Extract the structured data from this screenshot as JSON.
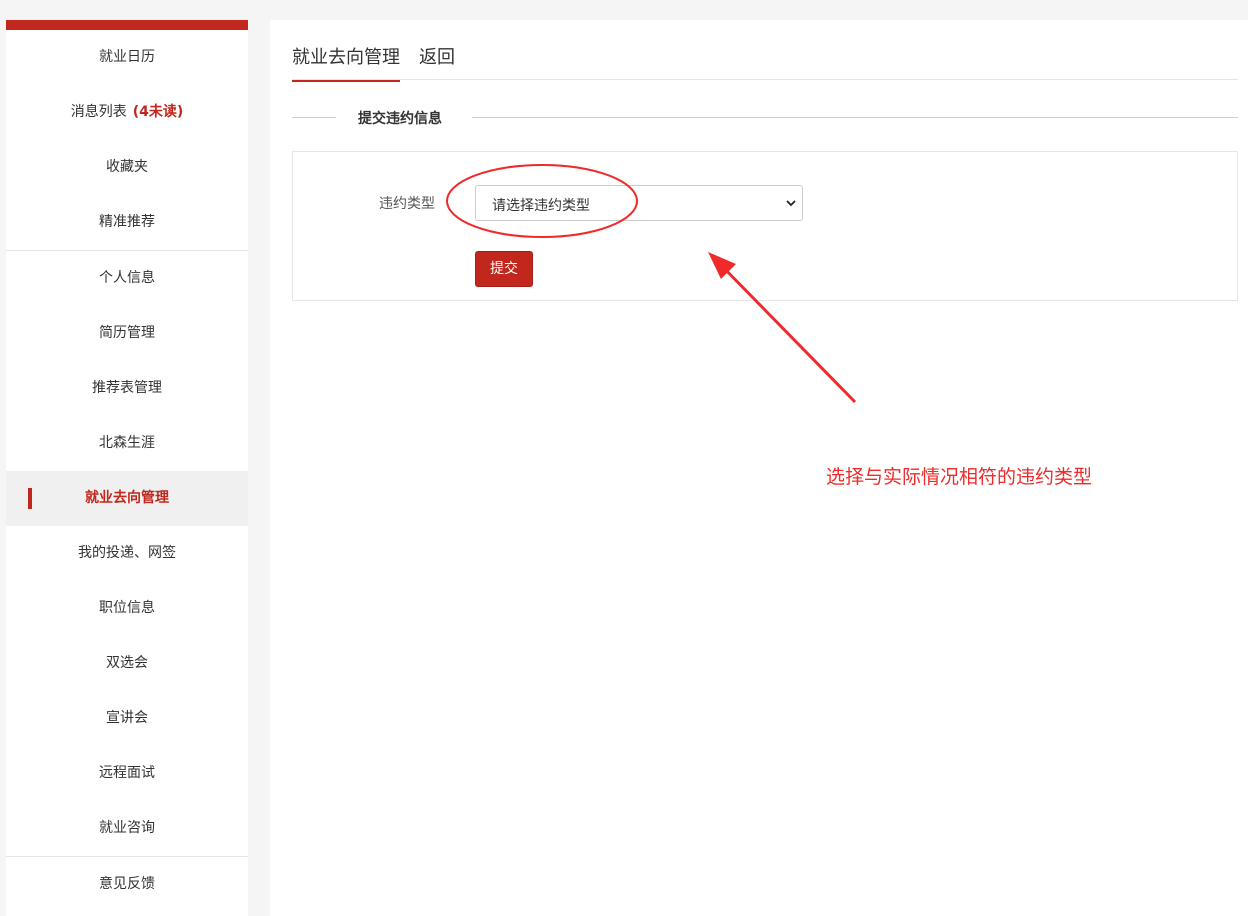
{
  "sidebar": {
    "items": [
      {
        "label": "就业日历"
      },
      {
        "label": "消息列表",
        "badge": "(4未读)"
      },
      {
        "label": "收藏夹"
      },
      {
        "label": "精准推荐"
      },
      {
        "label": "个人信息"
      },
      {
        "label": "简历管理"
      },
      {
        "label": "推荐表管理"
      },
      {
        "label": "北森生涯"
      },
      {
        "label": "就业去向管理",
        "active": true
      },
      {
        "label": "我的投递、网签"
      },
      {
        "label": "职位信息"
      },
      {
        "label": "双选会"
      },
      {
        "label": "宣讲会"
      },
      {
        "label": "远程面试"
      },
      {
        "label": "就业咨询"
      },
      {
        "label": "意见反馈"
      }
    ]
  },
  "tabs": {
    "active": "就业去向管理",
    "back": "返回"
  },
  "section": {
    "title": "提交违约信息"
  },
  "form": {
    "violation_type_label": "违约类型",
    "violation_type_value": "请选择违约类型",
    "submit_label": "提交"
  },
  "annotation": {
    "text": "选择与实际情况相符的违约类型",
    "color": "#f02a2a"
  },
  "colors": {
    "accent": "#c1271c"
  }
}
